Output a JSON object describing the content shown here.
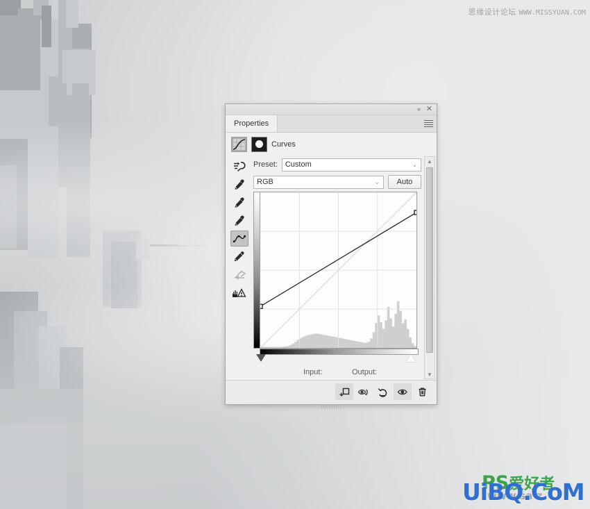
{
  "window": {
    "title": "Properties",
    "collapse_icon": "collapse-chevrons-icon",
    "close_icon": "close-icon",
    "menu_icon": "panel-menu-icon"
  },
  "tabs": [
    {
      "label": "Properties",
      "active": true
    }
  ],
  "adjustment": {
    "name": "Curves",
    "curve_thumb_icon": "curves-adjustment-icon",
    "mask_thumb_icon": "layer-mask-icon"
  },
  "tools": [
    {
      "name": "on-image-adjustment-tool",
      "label": "On-image adjustment",
      "selected": false,
      "disabled": false
    },
    {
      "name": "black-point-eyedropper",
      "label": "Sample in image to set black point",
      "selected": false,
      "disabled": false
    },
    {
      "name": "gray-point-eyedropper",
      "label": "Sample in image to set gray point",
      "selected": false,
      "disabled": false
    },
    {
      "name": "white-point-eyedropper",
      "label": "Sample in image to set white point",
      "selected": false,
      "disabled": false
    },
    {
      "name": "curve-point-tool",
      "label": "Edit points to modify the curve",
      "selected": true,
      "disabled": false
    },
    {
      "name": "pencil-tool",
      "label": "Draw to modify the curve",
      "selected": false,
      "disabled": false
    },
    {
      "name": "smooth-curve-tool",
      "label": "Smooth the curve values",
      "selected": false,
      "disabled": true
    },
    {
      "name": "clipping-warning-toggle",
      "label": "Show clipping for black/white points",
      "selected": false,
      "disabled": false
    }
  ],
  "preset": {
    "label": "Preset:",
    "value": "Custom",
    "chevron": "⌄"
  },
  "channel": {
    "value": "RGB",
    "chevron": "⌄",
    "auto_label": "Auto"
  },
  "graph": {
    "input_label": "Input:",
    "output_label": "Output:",
    "input_value": "",
    "output_value": "",
    "grid_divisions": 4,
    "black_slider_position": 0,
    "white_slider_position": 255
  },
  "chart_data": {
    "type": "line",
    "title": "Curves (RGB)",
    "xlabel": "Input",
    "ylabel": "Output",
    "xlim": [
      0,
      255
    ],
    "ylim": [
      0,
      255
    ],
    "grid": true,
    "grid_divisions": 4,
    "baseline": {
      "name": "Identity diagonal",
      "points": [
        [
          0,
          0
        ],
        [
          255,
          255
        ]
      ]
    },
    "series": [
      {
        "name": "RGB curve",
        "control_points": [
          [
            0,
            68
          ],
          [
            255,
            222
          ]
        ],
        "points": [
          [
            0,
            68
          ],
          [
            255,
            222
          ]
        ]
      }
    ],
    "histogram": {
      "name": "Image histogram",
      "bins": 64,
      "values": [
        2,
        2,
        2,
        2,
        2,
        2,
        2,
        2,
        2,
        3,
        3,
        4,
        6,
        9,
        13,
        17,
        20,
        23,
        25,
        27,
        28,
        29,
        30,
        30,
        29,
        28,
        27,
        26,
        25,
        24,
        23,
        22,
        21,
        20,
        19,
        18,
        17,
        16,
        15,
        14,
        13,
        12,
        11,
        11,
        13,
        20,
        33,
        52,
        68,
        54,
        40,
        58,
        86,
        62,
        45,
        72,
        98,
        78,
        52,
        60,
        40,
        22,
        10,
        4
      ]
    }
  },
  "footer": {
    "buttons": [
      {
        "name": "clip-to-layer-button",
        "label": "Clip to layer",
        "active": true
      },
      {
        "name": "view-previous-state-button",
        "label": "View previous state",
        "active": false
      },
      {
        "name": "reset-button",
        "label": "Reset to adjustment defaults",
        "active": false
      },
      {
        "name": "toggle-visibility-button",
        "label": "Toggle layer visibility",
        "active": true
      },
      {
        "name": "delete-button",
        "label": "Delete this adjustment layer",
        "active": false
      }
    ]
  },
  "watermarks": {
    "top_cn": "思缘设计论坛",
    "top_en": "WWW.MISSYUAN.COM",
    "bottom_blue": "UiBQ.CoM",
    "bottom_green_ps": "PS",
    "bottom_green_cn": "爱好者",
    "bottom_grey": "www.sa z"
  }
}
